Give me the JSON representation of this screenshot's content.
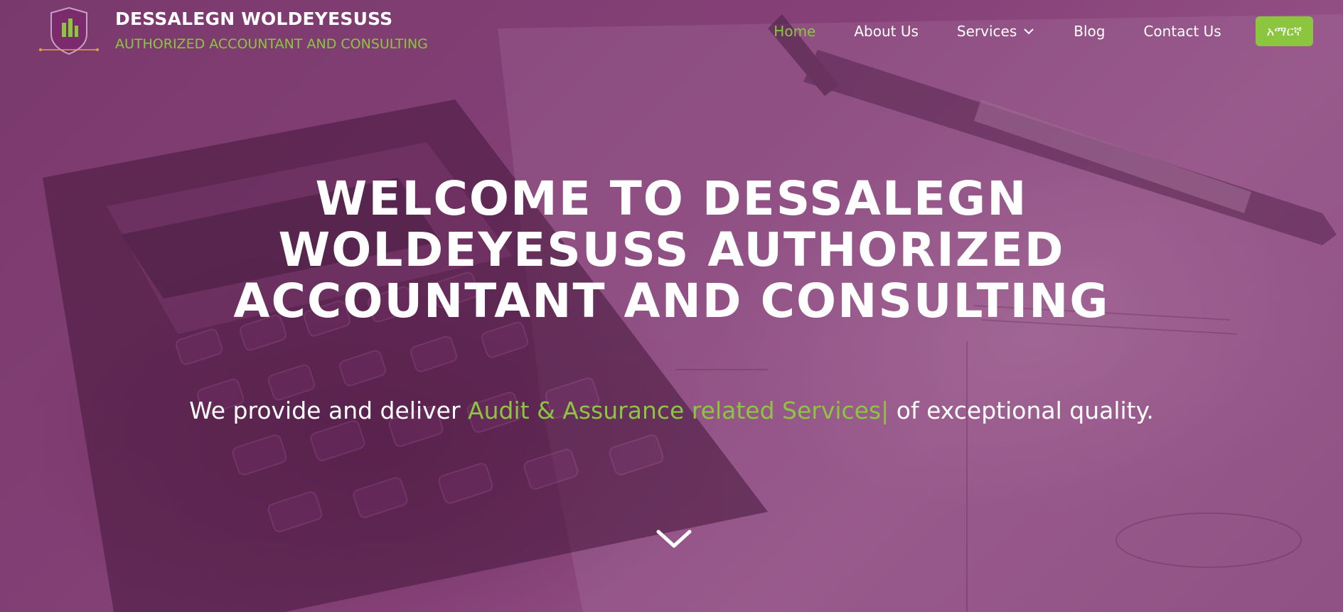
{
  "brand": {
    "name": "DESSALEGN WOLDEYESUSS",
    "tagline": "AUTHORIZED ACCOUNTANT AND CONSULTING"
  },
  "nav": {
    "home": "Home",
    "about": "About Us",
    "services": "Services",
    "blog": "Blog",
    "contact": "Contact Us",
    "language": "አማርኛ"
  },
  "hero": {
    "title": "WELCOME TO DESSALEGN WOLDEYESUSS AUTHORIZED ACCOUNTANT AND CONSULTING",
    "subtitle_prefix": "We provide and deliver ",
    "subtitle_highlight": "Audit & Assurance related Services|",
    "subtitle_suffix": " of exceptional quality."
  },
  "icons": {
    "logo": "shield-logo",
    "services_dropdown": "chevron-down-icon",
    "scroll": "chevron-down-icon"
  },
  "colors": {
    "accent": "#8cc63f",
    "overlay": "#7b3f6e",
    "text": "#ffffff"
  }
}
